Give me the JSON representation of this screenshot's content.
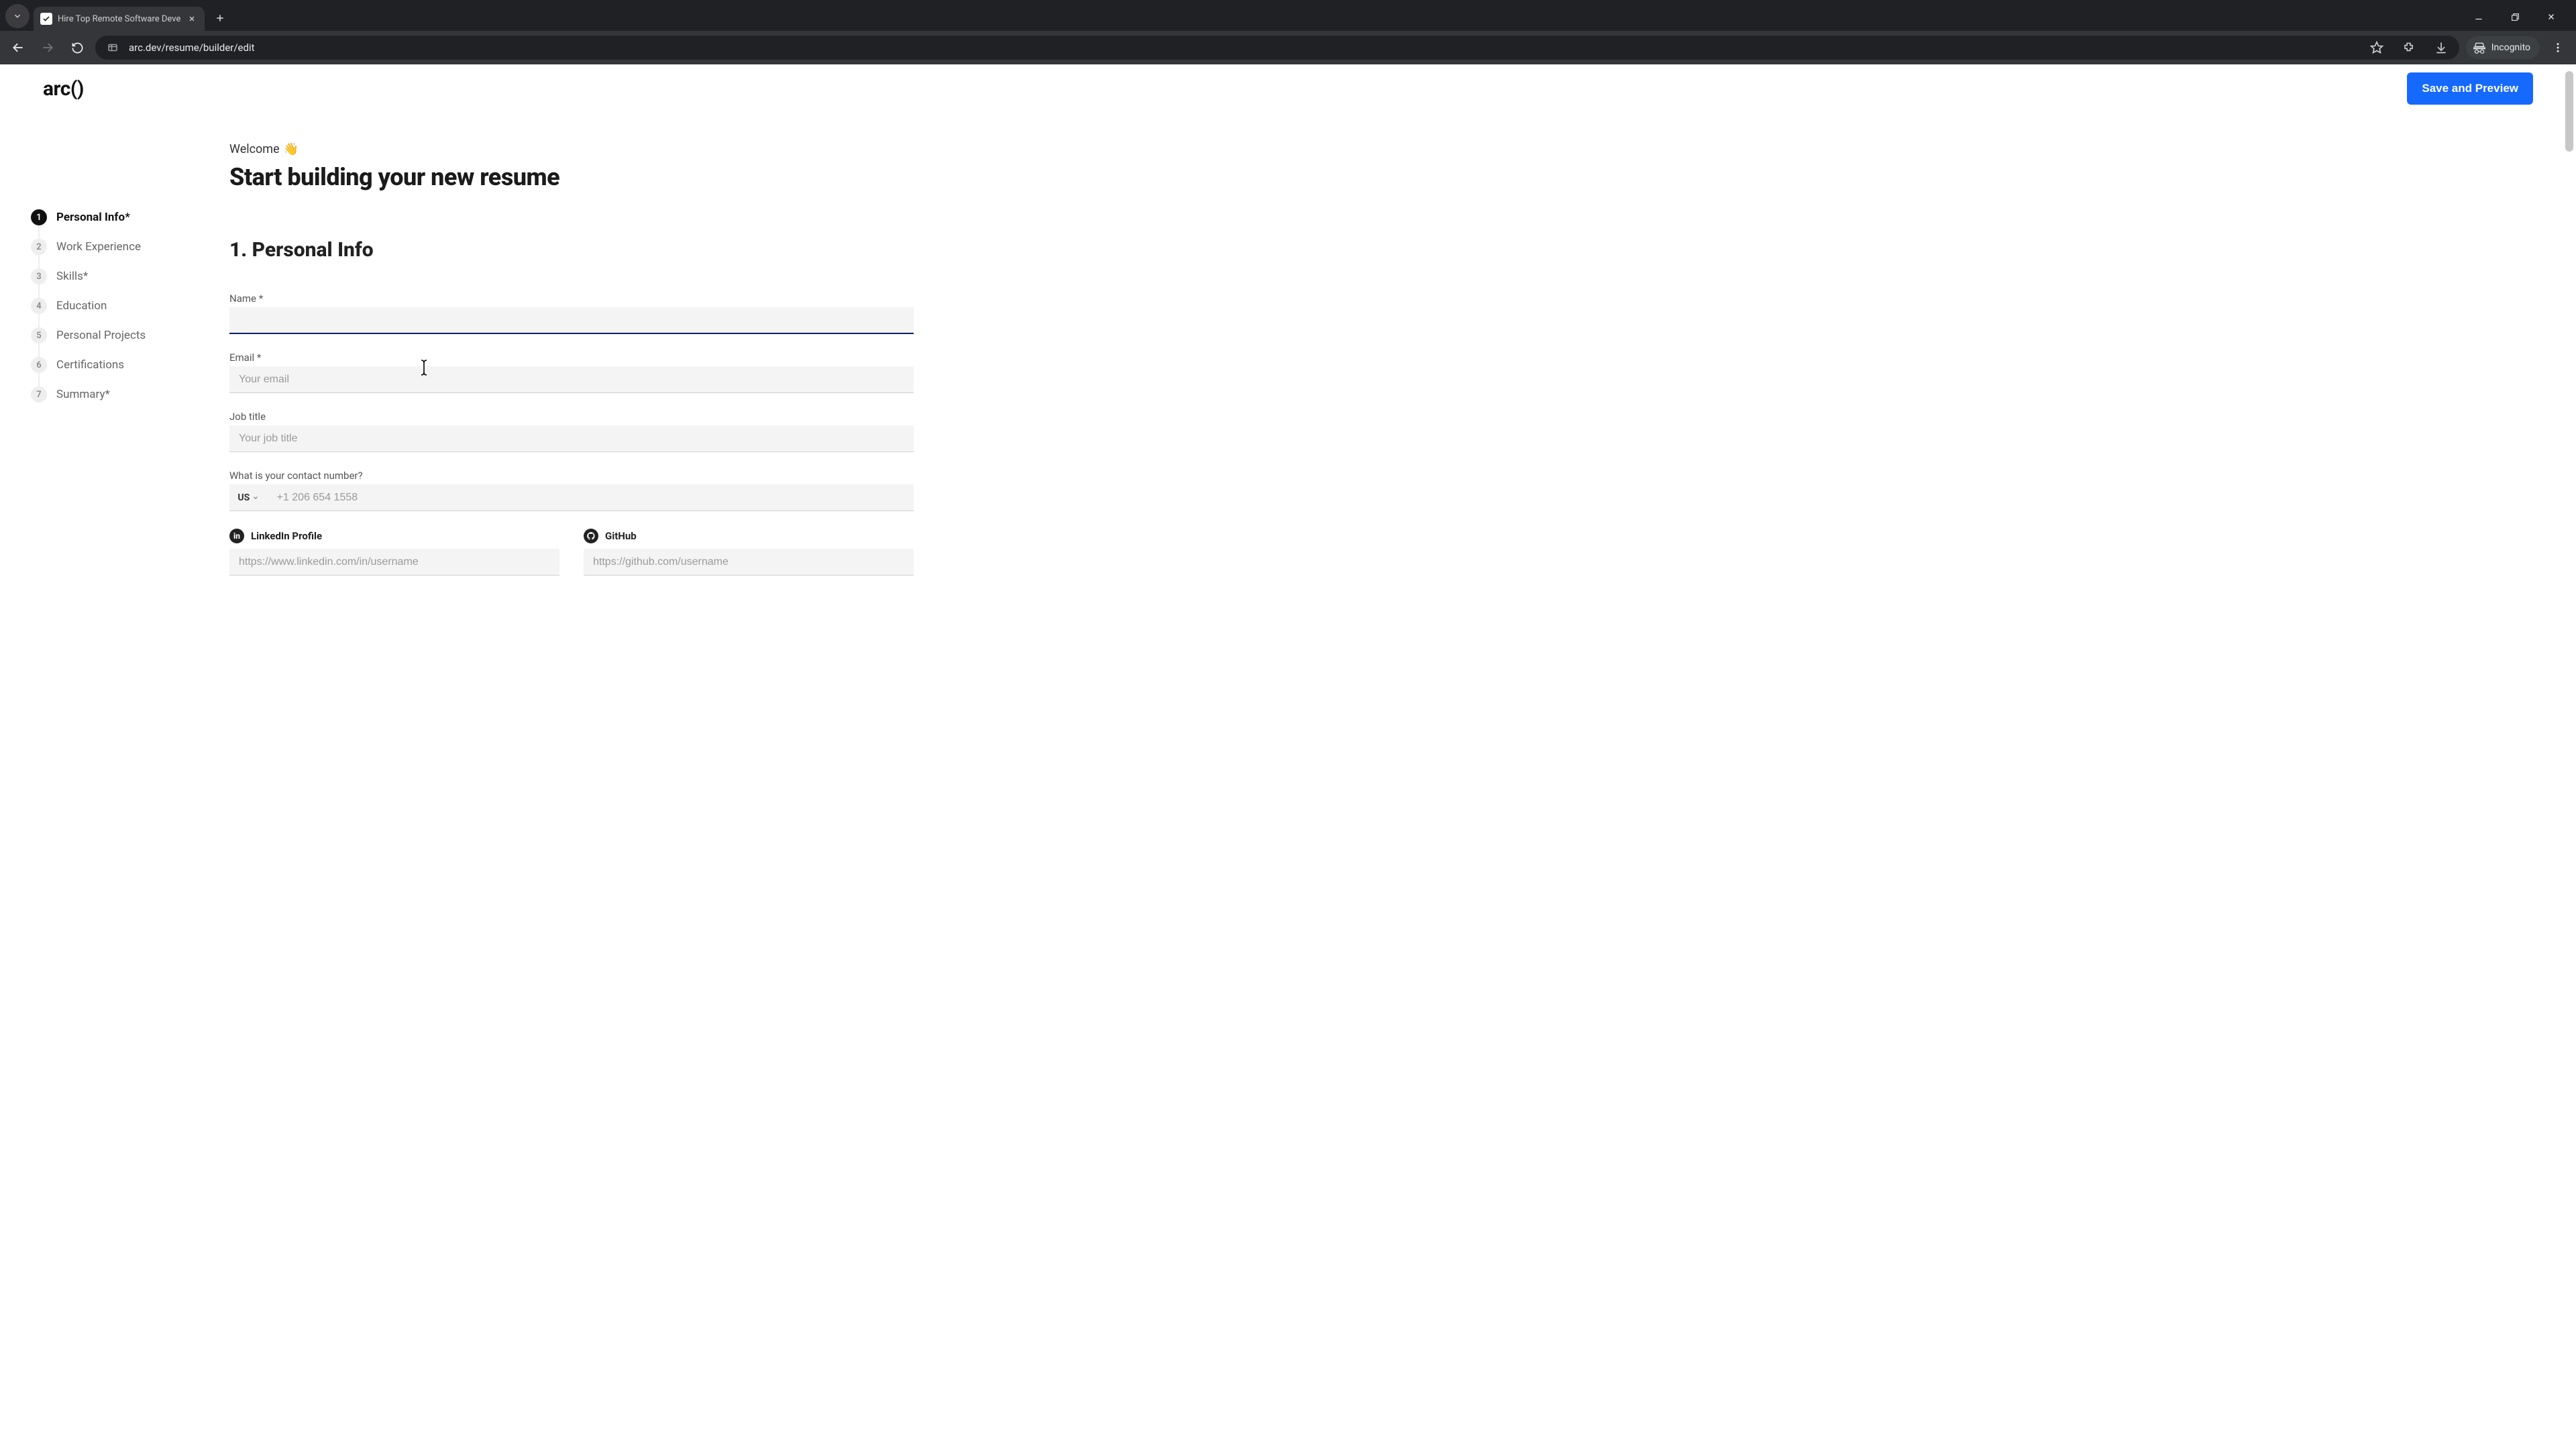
{
  "browser": {
    "tab_title": "Hire Top Remote Software Deve",
    "url": "arc.dev/resume/builder/edit",
    "incognito_label": "Incognito"
  },
  "header": {
    "logo": "arc()",
    "save_label": "Save and Preview"
  },
  "sidebar": {
    "items": [
      {
        "num": "1",
        "label": "Personal Info*"
      },
      {
        "num": "2",
        "label": "Work Experience"
      },
      {
        "num": "3",
        "label": "Skills*"
      },
      {
        "num": "4",
        "label": "Education"
      },
      {
        "num": "5",
        "label": "Personal Projects"
      },
      {
        "num": "6",
        "label": "Certifications"
      },
      {
        "num": "7",
        "label": "Summary*"
      }
    ]
  },
  "main": {
    "welcome": "Welcome",
    "wave_emoji": "👋",
    "headline": "Start building your new resume",
    "section_title": "1. Personal Info",
    "fields": {
      "name_label": "Name",
      "name_required": "*",
      "email_label": "Email",
      "email_required": "*",
      "email_placeholder": "Your email",
      "jobtitle_label": "Job title",
      "jobtitle_placeholder": "Your job title",
      "phone_label": "What is your contact number?",
      "phone_country": "US",
      "phone_placeholder": "+1 206 654 1558",
      "linkedin_label": "LinkedIn Profile",
      "linkedin_placeholder": "https://www.linkedin.com/in/username",
      "github_label": "GitHub",
      "github_placeholder": "https://github.com/username"
    }
  },
  "colors": {
    "primary_button": "#1569ff",
    "focus_underline": "#0a1f6b"
  }
}
